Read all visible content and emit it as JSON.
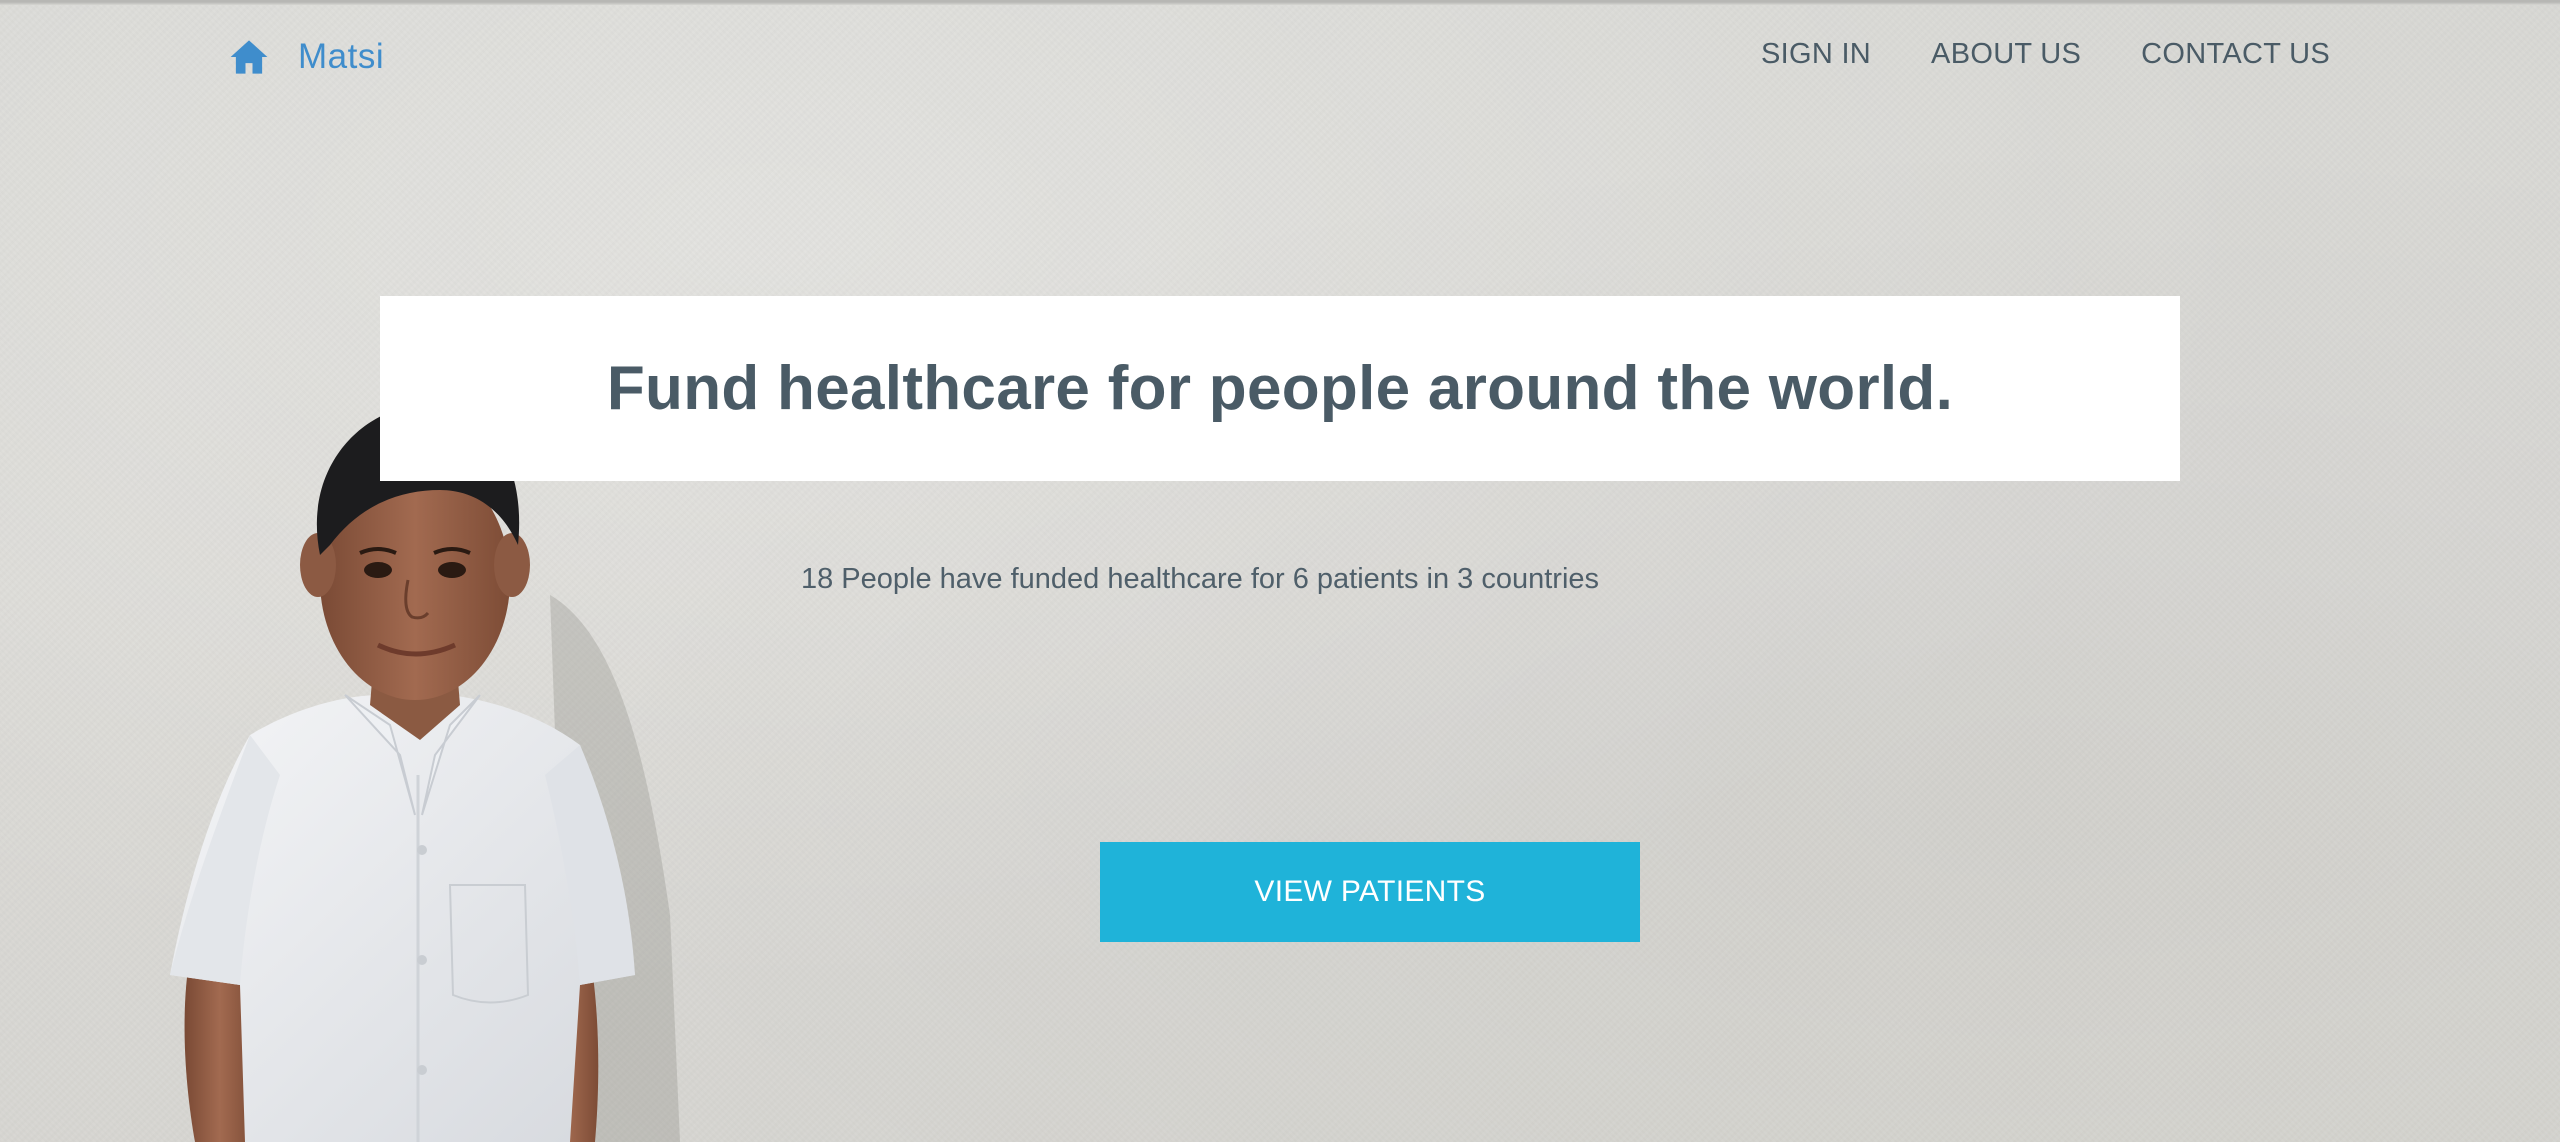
{
  "header": {
    "brand_name": "Matsi",
    "home_icon": "home-icon",
    "nav": [
      {
        "label": "SIGN IN"
      },
      {
        "label": "ABOUT US"
      },
      {
        "label": "CONTACT US"
      }
    ]
  },
  "hero": {
    "headline": "Fund healthcare for people around the world.",
    "stats": "18 People have funded healthcare for 6 patients in 3 countries",
    "cta_label": "VIEW PATIENTS"
  },
  "colors": {
    "brand": "#3f8dcc",
    "text": "#4a5b66",
    "cta": "#1fb3d9",
    "background": "#d9d9d5"
  }
}
